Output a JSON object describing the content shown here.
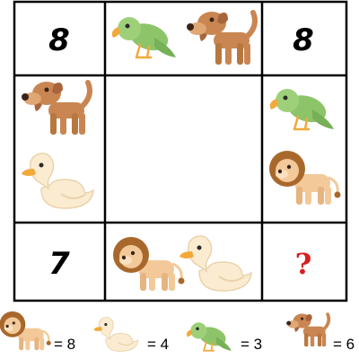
{
  "puzzle": {
    "corners": {
      "top_left": "8",
      "top_right": "8",
      "bottom_left": "7",
      "bottom_right": "?"
    },
    "edges": {
      "top": [
        "parrot",
        "dog"
      ],
      "left": [
        "dog",
        "duck"
      ],
      "right": [
        "parrot",
        "lion"
      ],
      "bottom": [
        "lion",
        "duck"
      ]
    },
    "center": "empty"
  },
  "legend": [
    {
      "animal": "lion",
      "label": "= 8"
    },
    {
      "animal": "duck",
      "label": "= 4"
    },
    {
      "animal": "parrot",
      "label": "= 3"
    },
    {
      "animal": "dog",
      "label": "= 6"
    }
  ],
  "colors": {
    "grid": "#000000",
    "question": "#d62020",
    "dog": "#c98652",
    "parrot": "#8dc46a",
    "duck": "#fbecd1",
    "lion_mane": "#a8682c",
    "lion_body": "#f3c99a"
  }
}
